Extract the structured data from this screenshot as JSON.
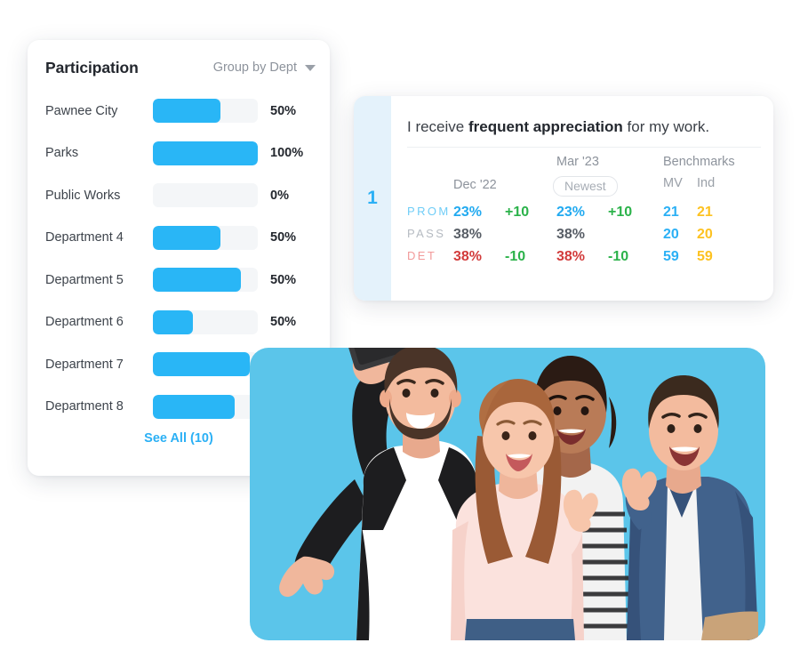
{
  "participation": {
    "title": "Participation",
    "group_by_label": "Group by Dept",
    "group_by_icon": "chevron-down-icon",
    "see_all_label": "See All (10)",
    "accent_color": "#29b6f6",
    "track_color": "#f4f6f8",
    "rows": [
      {
        "label": "Pawnee City",
        "percent_label": "50%",
        "fill_percent": 64
      },
      {
        "label": "Parks",
        "percent_label": "100%",
        "fill_percent": 100
      },
      {
        "label": "Public Works",
        "percent_label": "0%",
        "fill_percent": 0
      },
      {
        "label": "Department 4",
        "percent_label": "50%",
        "fill_percent": 64
      },
      {
        "label": "Department 5",
        "percent_label": "50%",
        "fill_percent": 84
      },
      {
        "label": "Department 6",
        "percent_label": "50%",
        "fill_percent": 38
      },
      {
        "label": "Department 7",
        "percent_label": "",
        "fill_percent": 92
      },
      {
        "label": "Department 8",
        "percent_label": "",
        "fill_percent": 78
      }
    ]
  },
  "survey": {
    "index_number": "1",
    "question_prefix": "I receive ",
    "question_emphasis": "frequent appreciation",
    "question_suffix": " for my work.",
    "strip_color": "#e4f2fb",
    "headers": {
      "dec": "Dec '22",
      "mar": "Mar '23",
      "newest_badge": "Newest",
      "benchmarks": "Benchmarks",
      "mv": "MV",
      "ind": "Ind"
    },
    "rows": [
      {
        "key": "PROM",
        "dec_value": "23%",
        "dec_delta": "+10",
        "mar_value": "23%",
        "mar_delta": "+10",
        "mv": "21",
        "ind": "21"
      },
      {
        "key": "PASS",
        "dec_value": "38%",
        "dec_delta": "",
        "mar_value": "38%",
        "mar_delta": "",
        "mv": "20",
        "ind": "20"
      },
      {
        "key": "DET",
        "dec_value": "38%",
        "dec_delta": "-10",
        "mar_value": "38%",
        "mar_delta": "-10",
        "mv": "59",
        "ind": "59"
      }
    ],
    "colors": {
      "prom": "#22aaf0",
      "pass": "#585e66",
      "det": "#d23b3b",
      "delta": "#2bb24a",
      "mv": "#2bb0f5",
      "ind": "#fdc221"
    }
  },
  "photo": {
    "background_color": "#5bc5ea",
    "description": "group-selfie-photo"
  }
}
